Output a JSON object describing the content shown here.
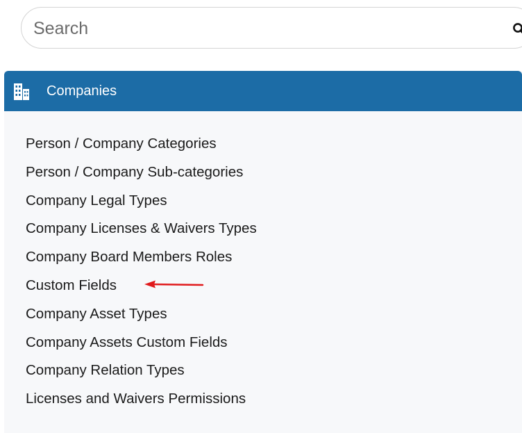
{
  "search": {
    "placeholder": "Search",
    "icon": "search-icon"
  },
  "panel": {
    "title": "Companies",
    "icon": "building-icon",
    "header_color": "#1c6ca6",
    "items": [
      {
        "label": "Person / Company Categories"
      },
      {
        "label": "Person / Company Sub-categories"
      },
      {
        "label": "Company Legal Types"
      },
      {
        "label": "Company Licenses & Waivers Types"
      },
      {
        "label": "Company Board Members Roles"
      },
      {
        "label": "Custom Fields"
      },
      {
        "label": "Company Asset Types"
      },
      {
        "label": "Company Assets Custom Fields"
      },
      {
        "label": "Company Relation Types"
      },
      {
        "label": "Licenses and Waivers Permissions"
      }
    ]
  },
  "annotation": {
    "icon": "arrow-left-icon",
    "color": "#e0191b"
  }
}
